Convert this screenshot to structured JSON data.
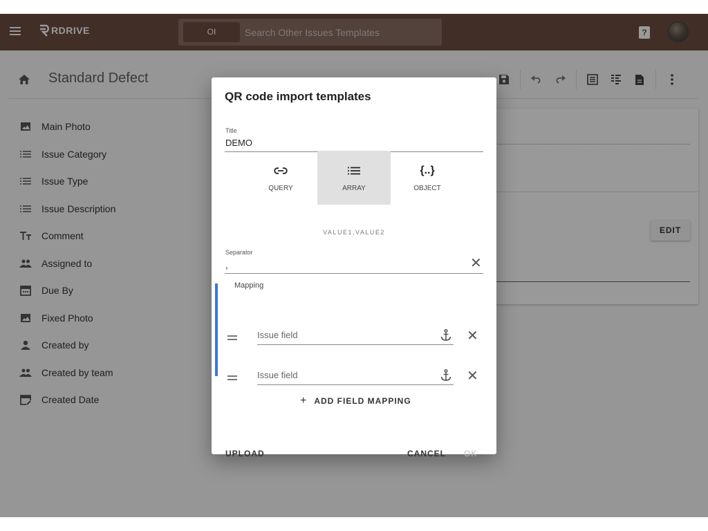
{
  "app": {
    "logo_text": "RDRIVE",
    "search": {
      "chip": "OI",
      "placeholder": "Search Other Issues Templates"
    },
    "help_label": "?"
  },
  "page": {
    "title": "Standard Defect",
    "toolbar_icons": [
      "save-icon",
      "undo-icon",
      "redo-icon",
      "list-view-icon",
      "detail-view-icon",
      "document-icon",
      "more-vert-icon"
    ]
  },
  "sidebar": {
    "items": [
      {
        "label": "Main Photo",
        "icon": "photo-icon"
      },
      {
        "label": "Issue Category",
        "icon": "list-icon"
      },
      {
        "label": "Issue Type",
        "icon": "list-icon"
      },
      {
        "label": "Issue Description",
        "icon": "list-icon"
      },
      {
        "label": "Comment",
        "icon": "text-icon"
      },
      {
        "label": "Assigned to",
        "icon": "people-icon"
      },
      {
        "label": "Due By",
        "icon": "calendar-icon"
      },
      {
        "label": "Fixed Photo",
        "icon": "photo-icon"
      },
      {
        "label": "Created by",
        "icon": "person-icon"
      },
      {
        "label": "Created by team",
        "icon": "people-icon"
      },
      {
        "label": "Created Date",
        "icon": "calendar-edit-icon"
      }
    ]
  },
  "card": {
    "edit_label": "EDIT"
  },
  "dialog": {
    "title": "QR code import templates",
    "title_field": {
      "label": "Title",
      "value": "DEMO"
    },
    "modes": [
      {
        "label": "QUERY",
        "icon": "link-icon",
        "selected": false
      },
      {
        "label": "ARRAY",
        "icon": "list-icon",
        "selected": true
      },
      {
        "label": "OBJECT",
        "icon": "braces-icon",
        "selected": false
      }
    ],
    "mode_icon_object": "{..}",
    "mode_hint": "VALUE1,VALUE2",
    "separator": {
      "label": "Separator",
      "value": ","
    },
    "mapping": {
      "label": "Mapping",
      "rows": [
        {
          "placeholder": "Issue field"
        },
        {
          "placeholder": "Issue field"
        }
      ],
      "add_label": "ADD FIELD MAPPING"
    },
    "actions": {
      "upload": "UPLOAD",
      "cancel": "CANCEL",
      "ok": "OK"
    }
  },
  "colors": {
    "topbar": "#6b4d42",
    "accent_bar": "#3a78d8"
  }
}
